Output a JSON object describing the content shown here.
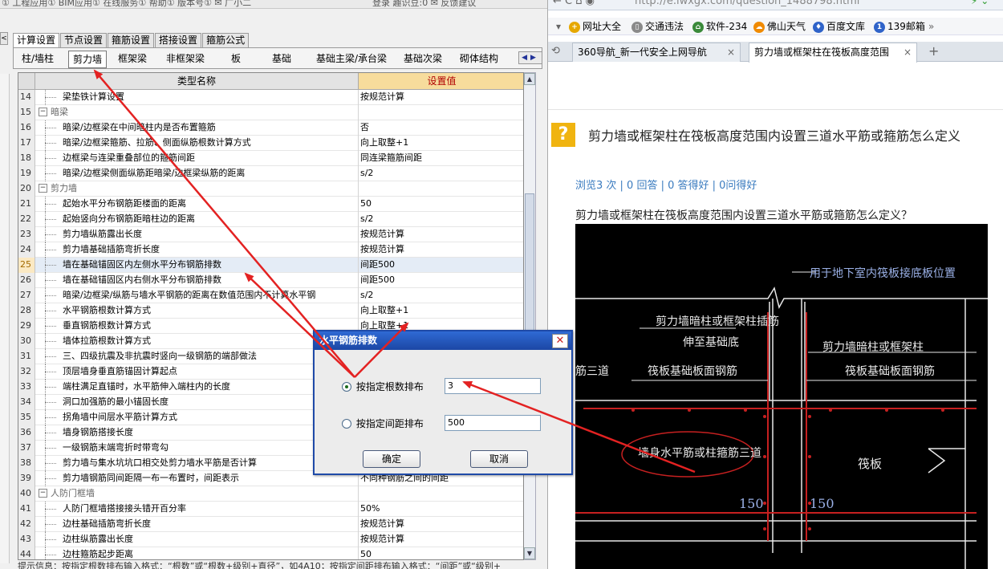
{
  "left_app": {
    "menubar_text": "①  工程应用①  BIM应用①  在线服务①  帮助①  版本号①  ✉ 广小二",
    "menubar_right": "登录   趣识豆:0  ✉ 反馈建议",
    "left_arrow": "<",
    "main_tabs": [
      {
        "label": "计算设置",
        "active": true
      },
      {
        "label": "节点设置",
        "active": false
      },
      {
        "label": "箍筋设置",
        "active": false
      },
      {
        "label": "搭接设置",
        "active": false
      },
      {
        "label": "箍筋公式",
        "active": false
      }
    ],
    "sub_tabs": [
      {
        "label": "柱/墙柱",
        "active": false
      },
      {
        "label": "剪力墙",
        "active": true
      },
      {
        "label": "框架梁",
        "active": false
      },
      {
        "label": "非框架梁",
        "active": false
      },
      {
        "label": "板",
        "active": false
      },
      {
        "label": "基础",
        "active": false
      },
      {
        "label": "基础主梁/承台梁",
        "active": false
      },
      {
        "label": "基础次梁",
        "active": false
      },
      {
        "label": "砌体结构",
        "active": false
      }
    ],
    "subtab_nav": "◀▶",
    "grid": {
      "col_name": "类型名称",
      "col_value": "设置值",
      "scroll_up": "▲",
      "scroll_down": "▼",
      "rows": [
        {
          "num": "14",
          "name": "梁垫铁计算设置",
          "value": "按规范计算",
          "group": false,
          "selected": false
        },
        {
          "num": "15",
          "name": "暗梁",
          "value": "",
          "group": true,
          "selected": false
        },
        {
          "num": "16",
          "name": "暗梁/边框梁在中间暗柱内是否布置箍筋",
          "value": "否",
          "group": false,
          "selected": false
        },
        {
          "num": "17",
          "name": "暗梁/边框梁箍筋、拉筋、侧面纵筋根数计算方式",
          "value": "向上取整+1",
          "group": false,
          "selected": false
        },
        {
          "num": "18",
          "name": "边框梁与连梁重叠部位的箍筋间距",
          "value": "同连梁箍筋间距",
          "group": false,
          "selected": false
        },
        {
          "num": "19",
          "name": "暗梁/边框梁侧面纵筋距暗梁/边框梁纵筋的距离",
          "value": "s/2",
          "group": false,
          "selected": false
        },
        {
          "num": "20",
          "name": "剪力墙",
          "value": "",
          "group": true,
          "selected": false
        },
        {
          "num": "21",
          "name": "起始水平分布钢筋距楼面的距离",
          "value": "50",
          "group": false,
          "selected": false
        },
        {
          "num": "22",
          "name": "起始竖向分布钢筋距暗柱边的距离",
          "value": "s/2",
          "group": false,
          "selected": false
        },
        {
          "num": "23",
          "name": "剪力墙纵筋露出长度",
          "value": "按规范计算",
          "group": false,
          "selected": false
        },
        {
          "num": "24",
          "name": "剪力墙基础插筋弯折长度",
          "value": "按规范计算",
          "group": false,
          "selected": false
        },
        {
          "num": "25",
          "name": "墙在基础锚固区内左侧水平分布钢筋排数",
          "value": "间距500",
          "group": false,
          "selected": true
        },
        {
          "num": "26",
          "name": "墙在基础锚固区内右侧水平分布钢筋排数",
          "value": "间距500",
          "group": false,
          "selected": false
        },
        {
          "num": "27",
          "name": "暗梁/边框梁/纵筋与墙水平钢筋的距离在数值范围内不计算水平钢",
          "value": "s/2",
          "group": false,
          "selected": false
        },
        {
          "num": "28",
          "name": "水平钢筋根数计算方式",
          "value": "向上取整+1",
          "group": false,
          "selected": false
        },
        {
          "num": "29",
          "name": "垂直钢筋根数计算方式",
          "value": "向上取整+1",
          "group": false,
          "selected": false
        },
        {
          "num": "30",
          "name": "墙体拉筋根数计算方式",
          "value": "",
          "group": false,
          "selected": false
        },
        {
          "num": "31",
          "name": "三、四级抗震及非抗震时竖向一级钢筋的端部做法",
          "value": "",
          "group": false,
          "selected": false
        },
        {
          "num": "32",
          "name": "顶层墙身垂直筋锚固计算起点",
          "value": "",
          "group": false,
          "selected": false
        },
        {
          "num": "33",
          "name": "端柱满足直锚时，水平筋伸入端柱内的长度",
          "value": "",
          "group": false,
          "selected": false
        },
        {
          "num": "34",
          "name": "洞口加强筋的最小锚固长度",
          "value": "",
          "group": false,
          "selected": false
        },
        {
          "num": "35",
          "name": "拐角墙中间层水平筋计算方式",
          "value": "",
          "group": false,
          "selected": false
        },
        {
          "num": "36",
          "name": "墙身钢筋搭接长度",
          "value": "",
          "group": false,
          "selected": false
        },
        {
          "num": "37",
          "name": "一级钢筋末端弯折时带弯勾",
          "value": "",
          "group": false,
          "selected": false
        },
        {
          "num": "38",
          "name": "剪力墙与集水坑坑口相交处剪力墙水平筋是否计算",
          "value": "",
          "group": false,
          "selected": false
        },
        {
          "num": "39",
          "name": "剪力墙钢筋同间距隔一布一布置时，间距表示",
          "value": "不同种钢筋之间的间距",
          "group": false,
          "selected": false
        },
        {
          "num": "40",
          "name": "人防门框墙",
          "value": "",
          "group": true,
          "selected": false
        },
        {
          "num": "41",
          "name": "人防门框墙搭接接头错开百分率",
          "value": "50%",
          "group": false,
          "selected": false
        },
        {
          "num": "42",
          "name": "边柱基础插筋弯折长度",
          "value": "按规范计算",
          "group": false,
          "selected": false
        },
        {
          "num": "43",
          "name": "边柱纵筋露出长度",
          "value": "按规范计算",
          "group": false,
          "selected": false
        },
        {
          "num": "44",
          "name": "边柱箍筋起步距离",
          "value": "50",
          "group": false,
          "selected": false
        }
      ]
    },
    "tip": "提示信息：按指定根数排布输入格式：“根数”或“根数+级别+直径”，如4A10；按指定间距排布输入格式：“间距”或“级别+"
  },
  "dialog": {
    "title": "水平钢筋排数",
    "close": "✕",
    "options": [
      {
        "label": "按指定根数排布",
        "value": "3",
        "checked": true
      },
      {
        "label": "按指定间距排布",
        "value": "500",
        "checked": false
      }
    ],
    "ok_label": "确定",
    "cancel_label": "取消"
  },
  "browser": {
    "nav_buttons": "←  C  ⌂  ◉",
    "url": "http://e.lwxgx.com/question_1488798.html",
    "addr_right": "⚡ ⌄",
    "bookmarks": [
      {
        "label": "网址大全",
        "icon": "+",
        "color": "#e6a800"
      },
      {
        "label": "交通违法",
        "icon": "▯",
        "color": "#8a8a8a"
      },
      {
        "label": "软件-234",
        "icon": "⌂",
        "color": "#3a8a3a"
      },
      {
        "label": "佛山天气",
        "icon": "☁",
        "color": "#f08a00"
      },
      {
        "label": "百度文库",
        "icon": "♦",
        "color": "#2f63c9"
      },
      {
        "label": "139邮箱",
        "icon": "1",
        "color": "#2f63c9"
      }
    ],
    "bookmarks_more": "»",
    "tabs": [
      {
        "label": "360导航_新一代安全上网导航",
        "active": false
      },
      {
        "label": "剪力墙或框架柱在筏板高度范围",
        "active": true
      }
    ],
    "new_tab": "+",
    "tab_close": "×",
    "question_icon": "?",
    "question_title": "剪力墙或框架柱在筏板高度范围内设置三道水平筋或箍筋怎么定义",
    "stats": "浏览3 次 | 0 回答 | 0 答得好 | 0问得好",
    "question_text": "剪力墙或框架柱在筏板高度范围内设置三道水平筋或箍筋怎么定义？"
  },
  "drawing": {
    "labels": {
      "top_right": "用于地下室内筏板接底板位置",
      "wall_insert": "剪力墙暗柱或框架柱插筋",
      "extend": "伸至基础底",
      "wall_col": "剪力墙暗柱或框架柱",
      "left_cut": "筋三道",
      "raft_top_left": "筏板基础板面钢筋",
      "raft_top_right": "筏板基础板面钢筋",
      "circled": "墙身水平筋或柱箍筋三道",
      "raft": "筏板",
      "dim_left": "150",
      "dim_right": "150"
    }
  },
  "colors": {
    "annotation_red": "#e32222",
    "cad_white": "#e8e8e8",
    "cad_red": "#c62020",
    "cad_blue_text": "#9ab0e6",
    "title_blue": "#1f4aa8",
    "stats_blue": "#3a7bbf"
  }
}
